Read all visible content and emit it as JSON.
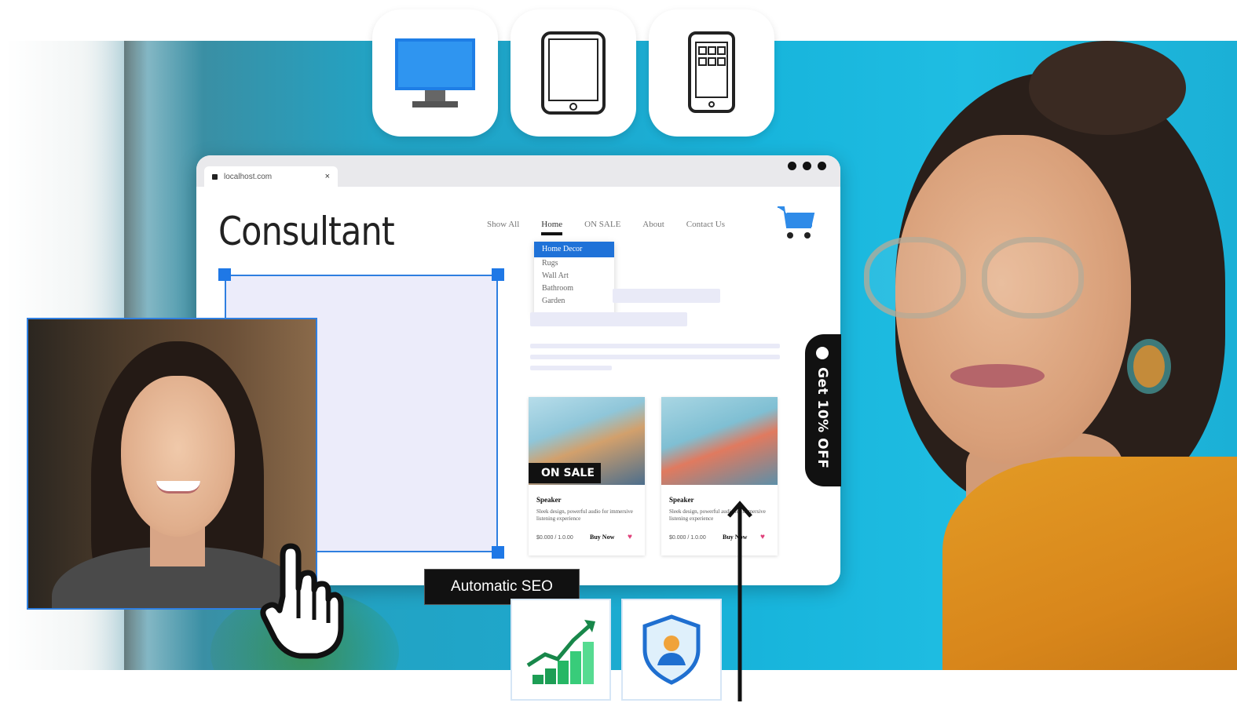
{
  "devices": [
    {
      "name": "desktop",
      "icon": "monitor-icon"
    },
    {
      "name": "tablet",
      "icon": "tablet-icon"
    },
    {
      "name": "mobile",
      "icon": "mobile-icon"
    }
  ],
  "browser": {
    "tab_label": "localhost.com",
    "tab_close": "×"
  },
  "site": {
    "title": "Consultant",
    "nav": [
      "Show All",
      "Home",
      "ON SALE",
      "About",
      "Contact Us"
    ],
    "dropdown": [
      "Home Decor",
      "Rugs",
      "Wall Art",
      "Bathroom",
      "Garden"
    ]
  },
  "products": [
    {
      "badge": "ON SALE",
      "title": "Speaker",
      "desc": "Sleek design, powerful audio for immersive listening experience",
      "price": "$0.000 / 1.0.00",
      "buy": "Buy Now"
    },
    {
      "badge": "",
      "title": "Speaker",
      "desc": "Sleek design, powerful audio for immersive listening experience",
      "price": "$0.000 / 1.0.00",
      "buy": "Buy Now"
    }
  ],
  "promo": {
    "label": "Get 10% OFF"
  },
  "tooltip": {
    "label": "Automatic SEO"
  },
  "features": [
    {
      "name": "seo-growth",
      "icon": "growth-chart-icon"
    },
    {
      "name": "security",
      "icon": "shield-user-icon"
    }
  ],
  "colors": {
    "accent": "#1f78e6",
    "promo_bg": "#111111",
    "sky": "#1ea7cc",
    "shirt": "#e39b25"
  }
}
